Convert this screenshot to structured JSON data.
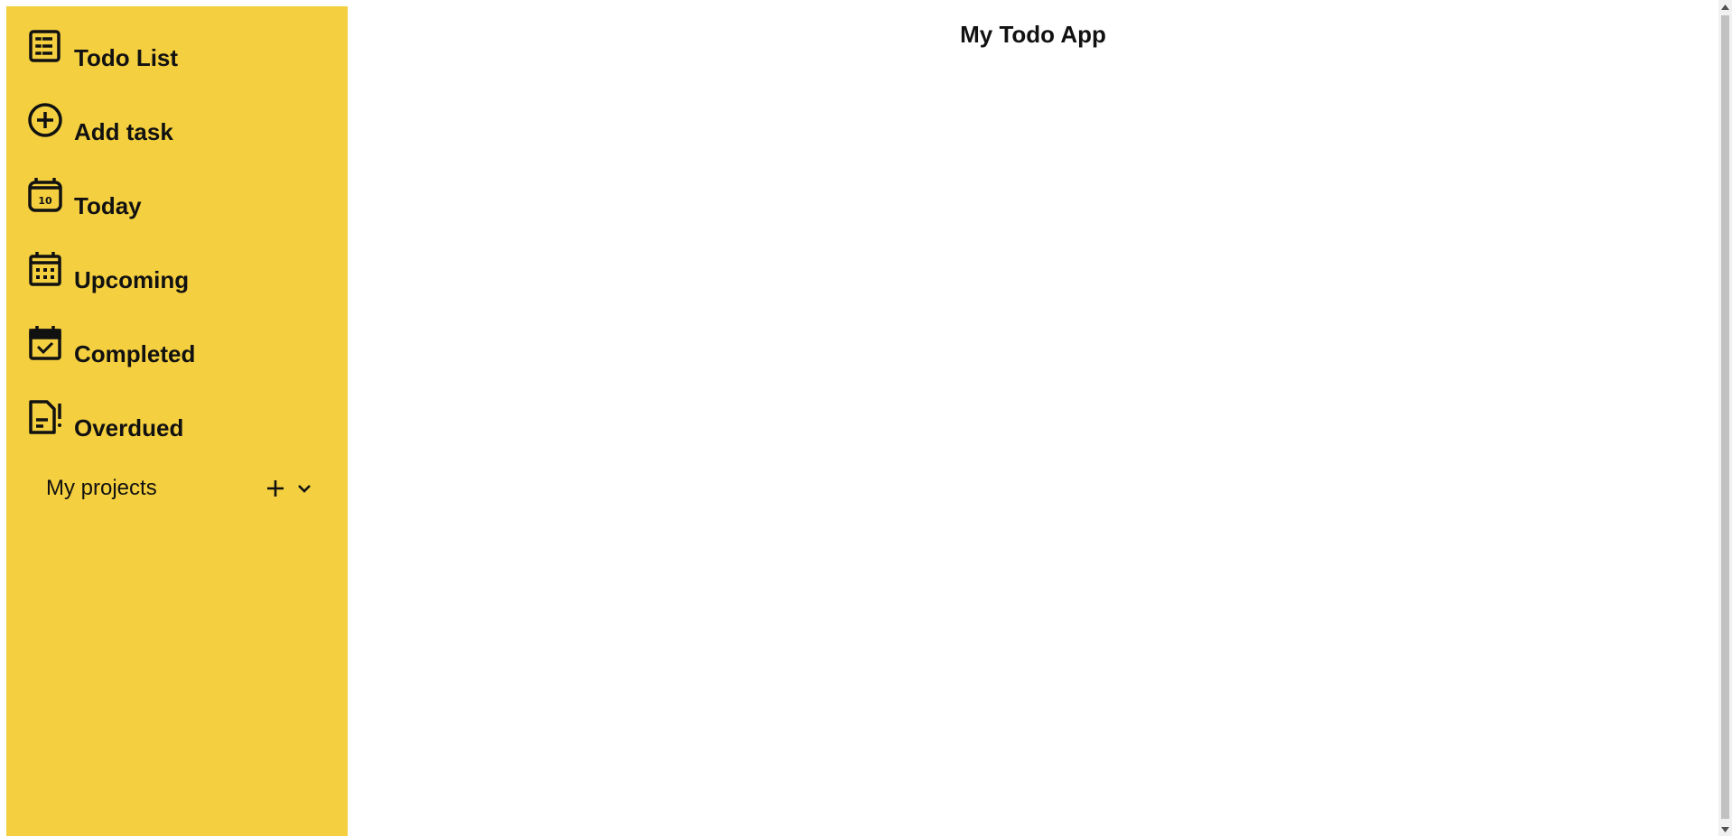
{
  "app": {
    "title": "My Todo App"
  },
  "sidebar": {
    "items": [
      {
        "label": "Todo List",
        "icon": "list-icon"
      },
      {
        "label": "Add task",
        "icon": "add-circle-icon"
      },
      {
        "label": "Today",
        "icon": "calendar-today-icon",
        "icon_text": "10"
      },
      {
        "label": "Upcoming",
        "icon": "calendar-grid-icon"
      },
      {
        "label": "Completed",
        "icon": "calendar-check-icon"
      },
      {
        "label": "Overdued",
        "icon": "document-alert-icon"
      }
    ],
    "projects": {
      "label": "My projects",
      "add_icon": "plus-icon",
      "toggle_icon": "chevron-down-icon"
    }
  },
  "colors": {
    "sidebar_background": "#f4cf3f",
    "main_background": "#ffffff",
    "text": "#111111"
  }
}
